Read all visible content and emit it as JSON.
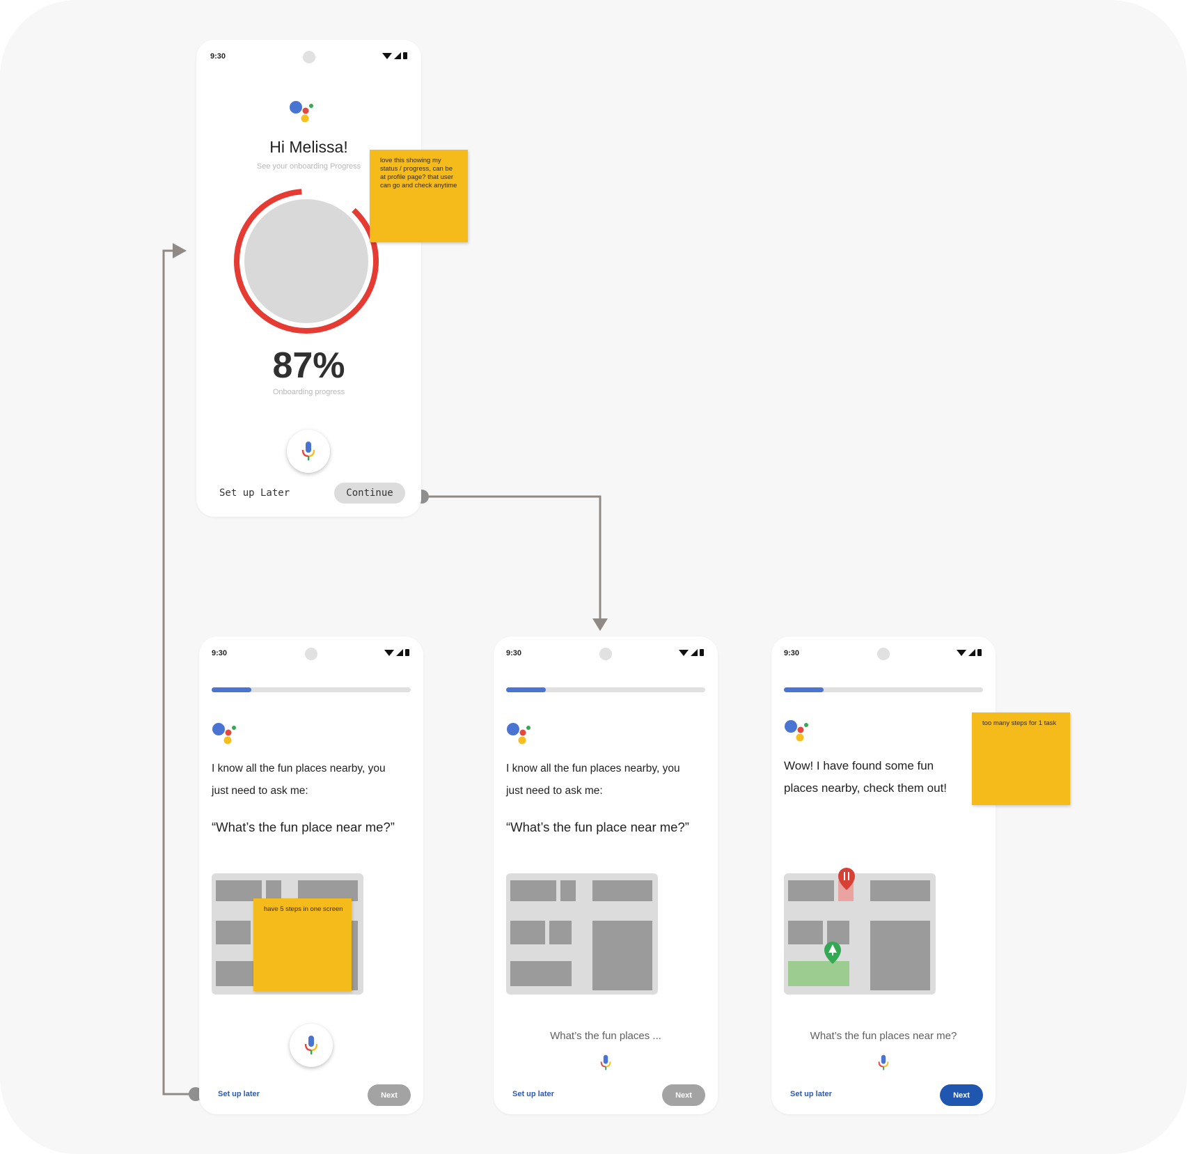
{
  "status_bar": {
    "time": "9:30"
  },
  "colors": {
    "assistant_blue": "#4a74d2",
    "assistant_red": "#e2483d",
    "assistant_yellow": "#f7bf1e",
    "assistant_green": "#34a853",
    "progress_ring": "#e53b33",
    "sticky_note": "#f5bb1b",
    "next_active": "#1f56b0",
    "next_inactive": "#a3a3a3",
    "connector": "#8f8a85"
  },
  "screen_progress": {
    "greeting": "Hi Melissa!",
    "subtitle": "See your onboarding Progress",
    "percent_text": "87%",
    "progress_value": 0.87,
    "progress_label": "Onboarding progress",
    "setup_later": "Set up Later",
    "continue_label": "Continue",
    "sticky": "love this showing my status / progress, can be at profile page? that user can go and check anytime"
  },
  "screen_step_1": {
    "step_progress": 0.2,
    "prompt": "I know all the fun places nearby, you just need to ask me:",
    "quote": "“What’s the fun place near me?”",
    "setup_later": "Set up later",
    "next_label": "Next",
    "sticky": "have 5 steps in one screen"
  },
  "screen_step_2": {
    "step_progress": 0.2,
    "prompt": "I know all the fun places nearby, you just need to ask me:",
    "quote": "“What’s the fun place near me?”",
    "listening": "What’s the fun places ...",
    "setup_later": "Set up later",
    "next_label": "Next"
  },
  "screen_step_3": {
    "step_progress": 0.2,
    "prompt": "Wow! I have found some fun places nearby, check them out!",
    "listening": "What’s the fun places near me?",
    "setup_later": "Set up later",
    "next_label": "Next",
    "sticky": "too many steps for 1 task"
  }
}
